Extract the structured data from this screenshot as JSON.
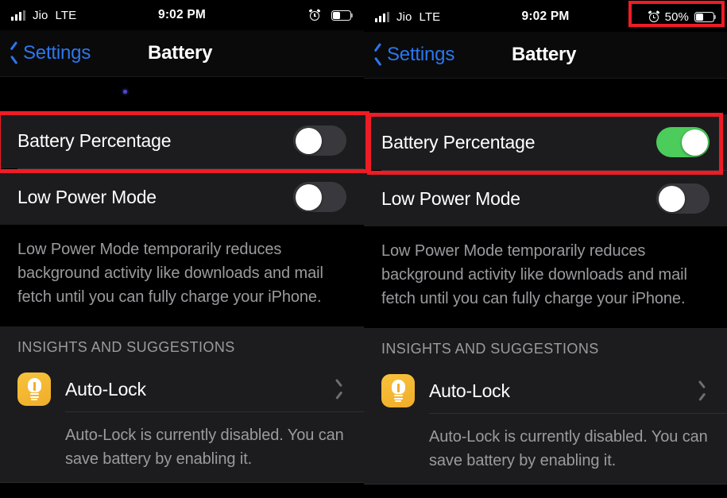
{
  "panels": [
    {
      "id": "before",
      "status_bar": {
        "signal_icon": "signal-bars-icon",
        "carrier": "Jio",
        "network_mode": "LTE",
        "time": "9:02 PM",
        "alarm_icon": "alarm-clock-icon",
        "battery_percentage_text": "",
        "battery_icon": "battery-icon"
      },
      "nav": {
        "back_icon": "chevron-left-icon",
        "back_label": "Settings",
        "title": "Battery"
      },
      "rows": [
        {
          "label": "Battery Percentage",
          "toggle_state": "off"
        },
        {
          "label": "Low Power Mode",
          "toggle_state": "off"
        }
      ],
      "low_power_description": "Low Power Mode temporarily reduces background activity like downloads and mail fetch until you can fully charge your iPhone.",
      "insights": {
        "header": "INSIGHTS AND SUGGESTIONS",
        "item_icon": "lightbulb-icon",
        "item_label": "Auto-Lock",
        "chevron_icon": "chevron-right-icon",
        "item_description": "Auto-Lock is currently disabled. You can save battery by enabling it."
      }
    },
    {
      "id": "after",
      "status_bar": {
        "signal_icon": "signal-bars-icon",
        "carrier": "Jio",
        "network_mode": "LTE",
        "time": "9:02 PM",
        "alarm_icon": "alarm-clock-icon",
        "battery_percentage_text": "50%",
        "battery_icon": "battery-icon"
      },
      "nav": {
        "back_icon": "chevron-left-icon",
        "back_label": "Settings",
        "title": "Battery"
      },
      "rows": [
        {
          "label": "Battery Percentage",
          "toggle_state": "on"
        },
        {
          "label": "Low Power Mode",
          "toggle_state": "off"
        }
      ],
      "low_power_description": "Low Power Mode temporarily reduces background activity like downloads and mail fetch until you can fully charge your iPhone.",
      "insights": {
        "header": "INSIGHTS AND SUGGESTIONS",
        "item_icon": "lightbulb-icon",
        "item_label": "Auto-Lock",
        "chevron_icon": "chevron-right-icon",
        "item_description": "Auto-Lock is currently disabled. You can save battery by enabling it."
      }
    }
  ],
  "annotations": {
    "highlight_color": "#ee1c25",
    "boxes": [
      {
        "name": "status-bar-battery-percentage-highlight"
      },
      {
        "name": "battery-percentage-row-highlight-before"
      },
      {
        "name": "battery-percentage-row-highlight-after"
      }
    ]
  },
  "colors": {
    "toggle_on": "#4ccc5a",
    "toggle_off": "#39393d",
    "accent_blue": "#2b76f0",
    "row_background": "#1c1c1e",
    "page_background": "#000000",
    "secondary_text": "#9b9b9f",
    "bulb_tile": "#f0ad2a"
  }
}
